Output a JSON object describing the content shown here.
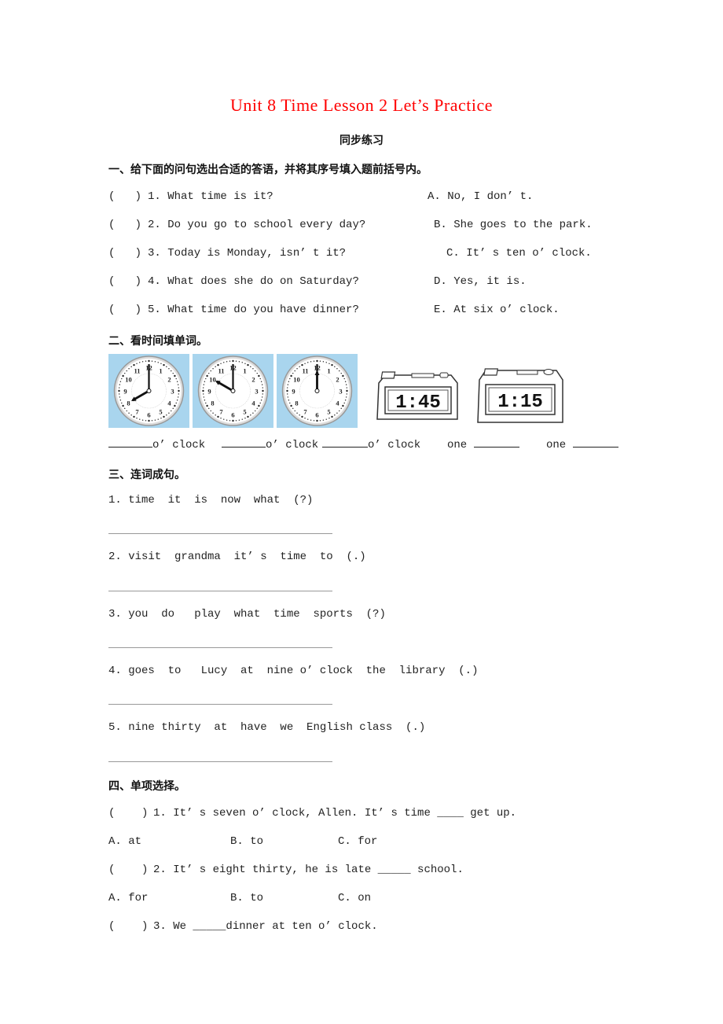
{
  "title": "Unit 8 Time Lesson 2 Let’s Practice",
  "subtitle": "同步练习",
  "section1": {
    "heading": "一、给下面的问句选出合适的答语，并将其序号填入题前括号内。",
    "questions": [
      {
        "bracket": "(   )",
        "text": "1. What time is it?"
      },
      {
        "bracket": "(   )",
        "text": "2. Do you go to school every day?"
      },
      {
        "bracket": "(   )",
        "text": "3. Today is Monday, isn’ t it?"
      },
      {
        "bracket": "(   )",
        "text": "4. What does she do on Saturday?"
      },
      {
        "bracket": "(   )",
        "text": "5. What time do you have dinner?"
      }
    ],
    "answers": [
      "A. No, I don’ t.",
      "B. She goes to the park.",
      "C. It’ s ten o’ clock.",
      "D. Yes, it is.",
      "E. At six o’ clock."
    ]
  },
  "section2": {
    "heading": "二、看时间填单词。",
    "analog_clocks": [
      {
        "name": "clock-eight",
        "hour": 8,
        "minute": 0
      },
      {
        "name": "clock-ten",
        "hour": 10,
        "minute": 0
      },
      {
        "name": "clock-twelve",
        "hour": 12,
        "minute": 0
      }
    ],
    "digital_clocks": [
      "1:45",
      "1:15"
    ],
    "fill_labels": [
      "o’ clock",
      "o’ clock",
      "o’ clock",
      "one",
      "one"
    ],
    "clock_bg_color": "#a9d5ee"
  },
  "section3": {
    "heading": "三、连词成句。",
    "items": [
      "1. time  it  is  now  what  (?)",
      "2. visit  grandma  it’ s  time  to  (.)",
      "3. you  do   play  what  time  sports  (?)",
      "4. goes  to   Lucy  at  nine o’ clock  the  library  (.)",
      "5. nine thirty  at  have  we  English class  (.)"
    ]
  },
  "section4": {
    "heading": "四、单项选择。",
    "questions": [
      {
        "bracket": "(    )",
        "text": "1. It’ s seven o’ clock, Allen. It’ s time ____ get up.",
        "options": [
          "A. at",
          "B. to",
          "C. for"
        ]
      },
      {
        "bracket": "(    )",
        "text": "2. It’ s eight thirty, he is late _____ school.",
        "options": [
          "A. for",
          "B. to",
          "C. on"
        ]
      },
      {
        "bracket": "(    )",
        "text": "3. We _____dinner at ten o’ clock.",
        "options": []
      }
    ]
  },
  "colors": {
    "title": "#ff0000"
  }
}
